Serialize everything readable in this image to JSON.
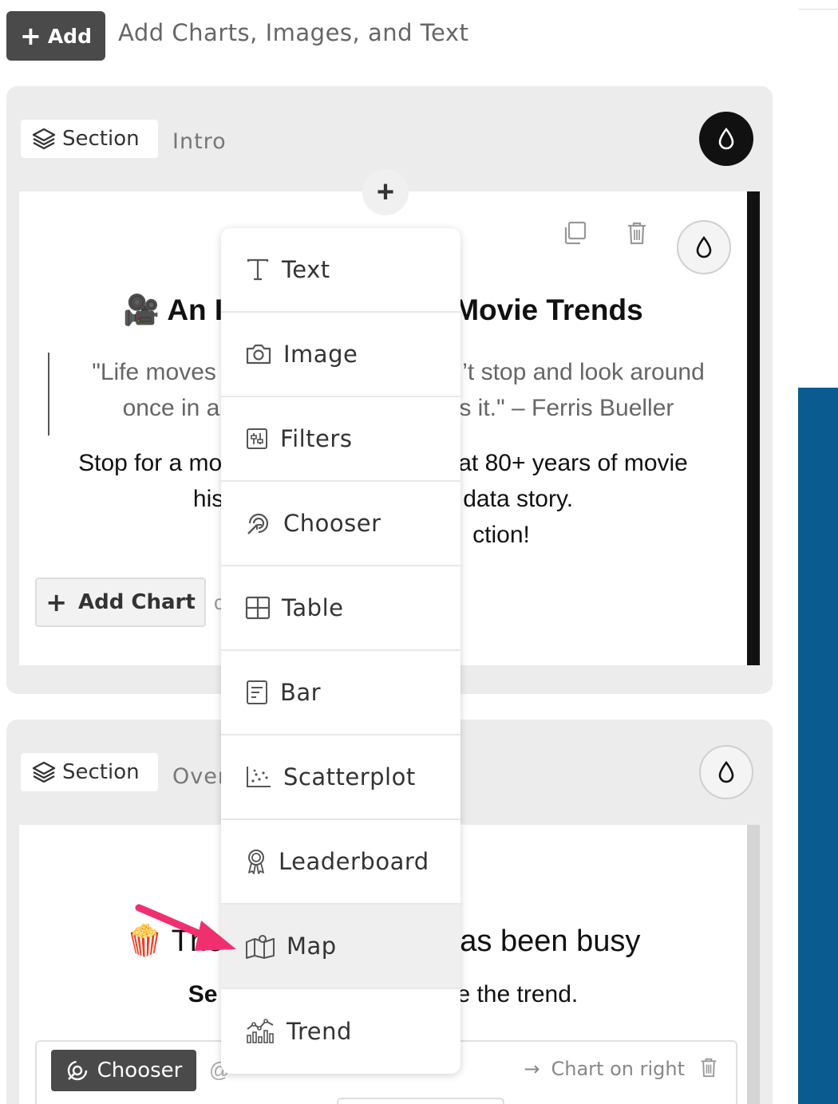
{
  "toolbar": {
    "add_label": "Add",
    "hint": "Add Charts, Images, and Text"
  },
  "section1": {
    "tag_label": "Section",
    "name": "Intro",
    "card": {
      "title_left": "🎥 An I",
      "title_right": "Movie Trends",
      "quote_lines": [
        "\"Life moves ",
        "’t stop and look around",
        "once in a",
        "s it.\" – Ferris Bueller"
      ],
      "body_lines": [
        "Stop for a mo",
        "at 80+ years of movie",
        "his",
        "data story.",
        "ction!"
      ],
      "add_chart_label": "Add Chart",
      "cut_letter": "c"
    }
  },
  "section2": {
    "tag_label": "Section",
    "name": "Over",
    "card": {
      "title_left": "🍿 The",
      "title_right": "as been busy",
      "sub_left": "Se",
      "sub_right": "e the trend.",
      "chooser_label": "Chooser",
      "at_sign": "@",
      "chart_position": "Chart on right"
    }
  },
  "menu": {
    "items": [
      {
        "label": "Text",
        "icon": "text-icon"
      },
      {
        "label": "Image",
        "icon": "camera-icon"
      },
      {
        "label": "Filters",
        "icon": "filters-icon"
      },
      {
        "label": "Chooser",
        "icon": "chooser-icon"
      },
      {
        "label": "Table",
        "icon": "table-icon"
      },
      {
        "label": "Bar",
        "icon": "bar-icon"
      },
      {
        "label": "Scatterplot",
        "icon": "scatterplot-icon"
      },
      {
        "label": "Leaderboard",
        "icon": "leaderboard-icon"
      },
      {
        "label": "Map",
        "icon": "map-icon"
      },
      {
        "label": "Trend",
        "icon": "trend-icon"
      }
    ],
    "hovered": "Map"
  },
  "colors": {
    "accent_dark": "#4a4a4a",
    "section_bg": "#ececec",
    "right_panel": "#0a5c90",
    "arrow": "#f0306e"
  }
}
